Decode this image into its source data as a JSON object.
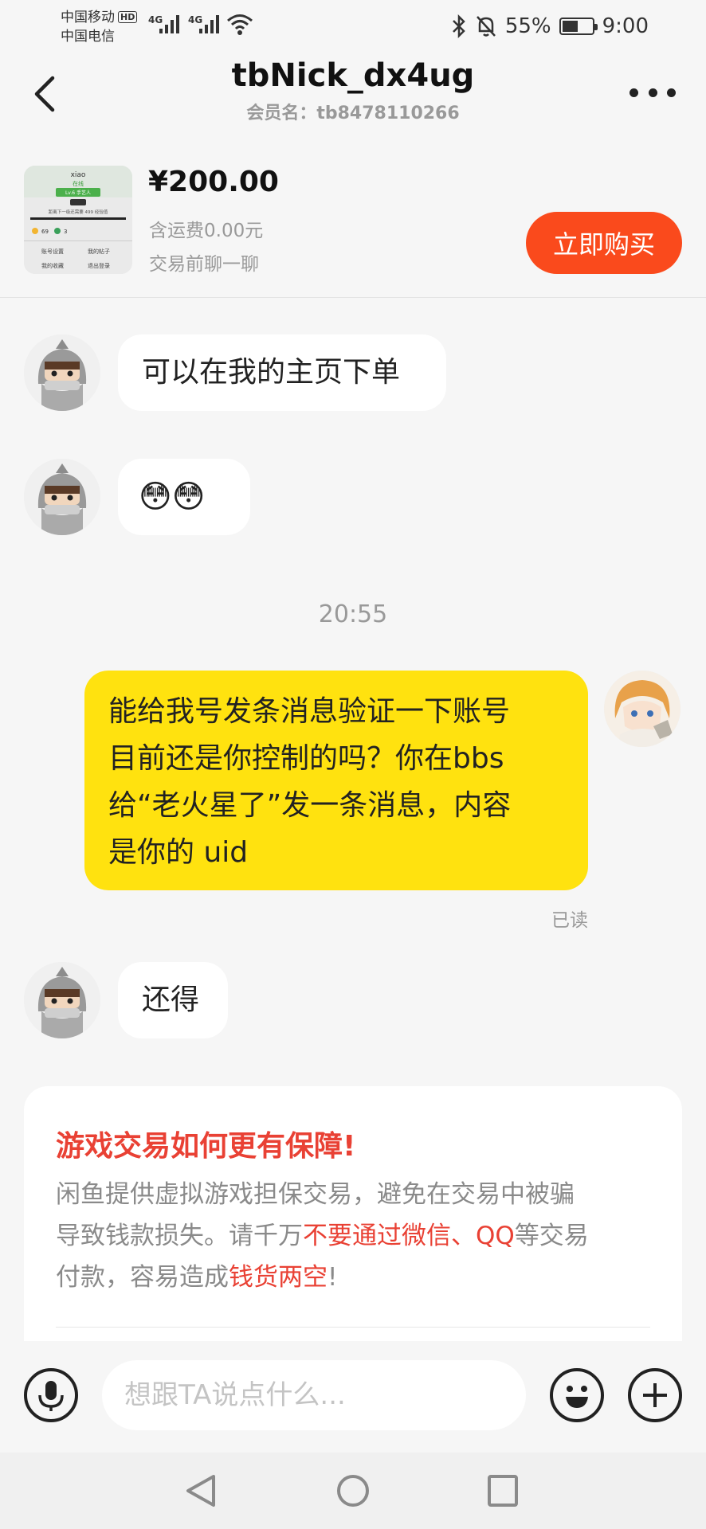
{
  "status_bar": {
    "carrier_1": "中国移动",
    "carrier_1_badge": "HD",
    "carrier_2": "中国电信",
    "network_1": "4G",
    "network_2": "4G",
    "battery_text": "55%",
    "battery_level": 0.55,
    "time": "9:00",
    "icons": [
      "signal-icon",
      "wifi-icon",
      "bluetooth-icon",
      "mute-bell-icon",
      "battery-icon"
    ]
  },
  "header": {
    "title": "tbNick_dx4ug",
    "subtitle": "会员名：tb8478110266",
    "back_icon": "back-arrow-icon",
    "more_icon": "more-dots-icon"
  },
  "product": {
    "price": "¥200.00",
    "shipping": "含运费0.00元",
    "chat_note": "交易前聊一聊",
    "buy_label": "立即购买",
    "thumb_texts": [
      "xiao",
      "在线",
      "Lv.6 手艺人",
      "距离下一级还需要 499 经验值",
      "69",
      "3",
      "账号设置",
      "我的帖子",
      "我的收藏",
      "退出登录"
    ]
  },
  "messages": [
    {
      "sender": "other",
      "text": "可以在我的主页下单"
    },
    {
      "sender": "other",
      "text": "😳😳"
    },
    {
      "sender": "me",
      "lines": [
        "能给我号发条消息验证一下账号",
        "目前还是你控制的吗？你在bbs",
        "给“老火星了”发一条消息，内容",
        "是你的 uid"
      ]
    },
    {
      "sender": "other",
      "text": "还得"
    }
  ],
  "timestamp": "20:55",
  "read_status": "已读",
  "notice": {
    "title": "游戏交易如何更有保障!",
    "line1": "闲鱼提供虚拟游戏担保交易，避免在交易中被骗",
    "line2_a": "导致钱款损失。请千万",
    "line2_red": "不要通过微信、QQ",
    "line2_b": "等交易",
    "line3_a": "付款，容易造成",
    "line3_red": "钱货两空",
    "line3_b": "!"
  },
  "input": {
    "placeholder": "想跟TA说点什么..."
  },
  "colors": {
    "accent": "#fa4a1c",
    "my_bubble": "#ffe20f",
    "warning_red": "#e94134",
    "background": "#f6f6f6"
  }
}
